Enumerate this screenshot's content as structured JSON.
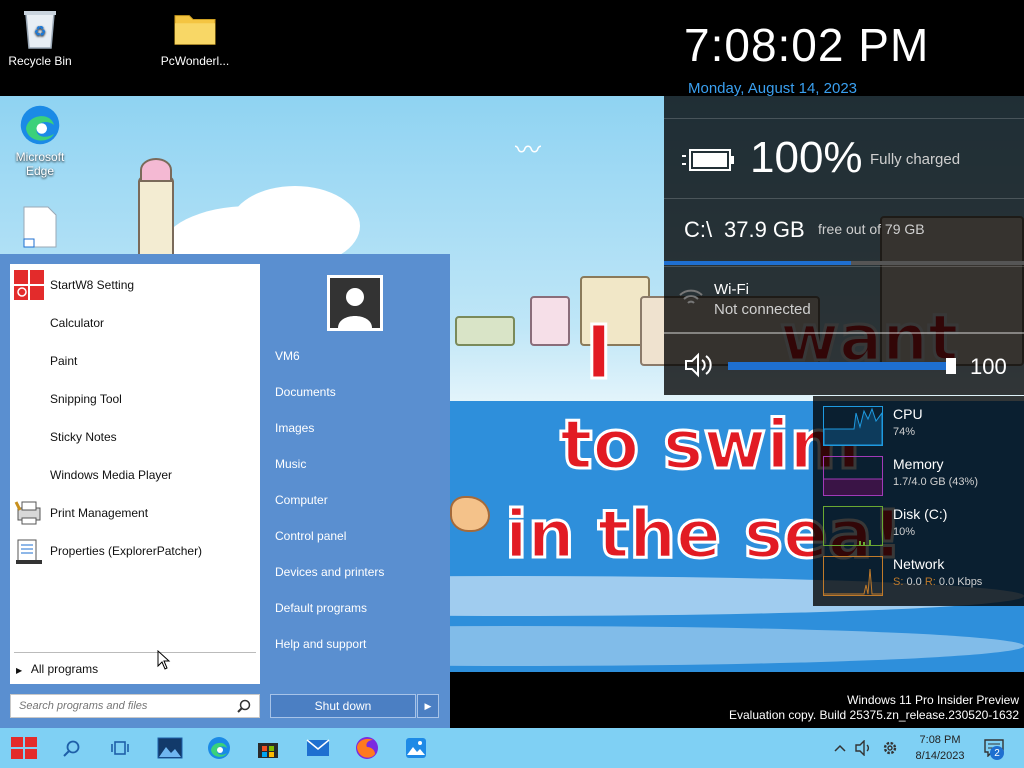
{
  "desktop": {
    "icons": [
      {
        "label": "Recycle Bin"
      },
      {
        "label": "PcWonderl..."
      },
      {
        "label": "Microsoft Edge"
      }
    ]
  },
  "clock": {
    "time": "7:08:02 PM",
    "date": "Monday, August 14, 2023"
  },
  "battery": {
    "percent": "100%",
    "status": "Fully charged"
  },
  "drive": {
    "label": "C:\\",
    "free": "37.9 GB",
    "desc": "free out of 79 GB",
    "used_fraction": 0.52
  },
  "wifi": {
    "name": "Wi-Fi",
    "status": "Not connected"
  },
  "volume": {
    "value": "100",
    "level": 1.0
  },
  "perf": {
    "cpu": {
      "name": "CPU",
      "value": "74%"
    },
    "memory": {
      "name": "Memory",
      "value": "1.7/4.0 GB (43%)"
    },
    "disk": {
      "name": "Disk (C:)",
      "value": "10%"
    },
    "network": {
      "name": "Network",
      "s_label": "S:",
      "s_value": "0.0",
      "r_label": "R:",
      "r_value": "0.0 Kbps"
    }
  },
  "start_menu": {
    "programs": [
      {
        "label": "StartW8 Setting"
      },
      {
        "label": "Calculator"
      },
      {
        "label": "Paint"
      },
      {
        "label": "Snipping Tool"
      },
      {
        "label": "Sticky Notes"
      },
      {
        "label": "Windows Media Player"
      },
      {
        "label": "Print Management"
      },
      {
        "label": "Properties (ExplorerPatcher)"
      }
    ],
    "all_programs": "All programs",
    "search_placeholder": "Search programs and files",
    "right_items": [
      {
        "label": "VM6"
      },
      {
        "label": "Documents"
      },
      {
        "label": "Images"
      },
      {
        "label": "Music"
      },
      {
        "label": "Computer"
      },
      {
        "label": "Control panel"
      },
      {
        "label": "Devices and printers"
      },
      {
        "label": "Default programs"
      },
      {
        "label": "Help and support"
      }
    ],
    "shutdown_label": "Shut down"
  },
  "watermark": {
    "line1": "Windows 11 Pro Insider Preview",
    "line2": "Evaluation copy. Build 25375.zn_release.230520-1632"
  },
  "wallpaper_text": {
    "line1": "I",
    "line2": "want",
    "line3": "to swim",
    "line4": "in the sea!"
  },
  "taskbar": {
    "time": "7:08 PM",
    "date": "8/14/2023",
    "notification_count": "2"
  }
}
